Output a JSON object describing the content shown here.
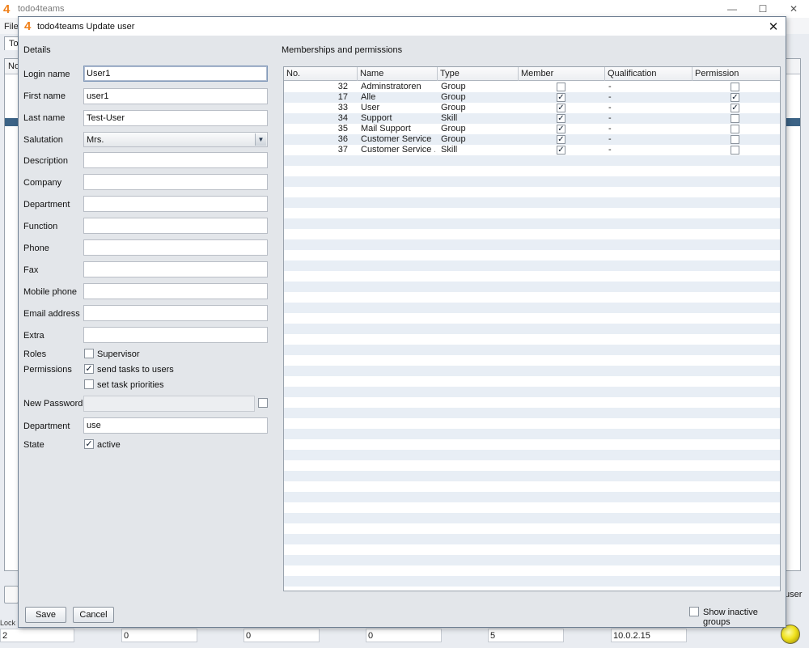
{
  "main_window": {
    "logo": "4",
    "title": "todo4teams",
    "menu_file": "File",
    "tab_label": "To",
    "table_header": "No",
    "user_label": "user",
    "lock_label": "Lock",
    "status_cells": [
      "2",
      "0",
      "0",
      "0",
      "5",
      "10.0.2.15"
    ]
  },
  "dialog": {
    "logo": "4",
    "title": "todo4teams Update user",
    "details_heading": "Details",
    "fields": {
      "login_name": {
        "label": "Login name",
        "value": "User1"
      },
      "first_name": {
        "label": "First name",
        "value": "user1"
      },
      "last_name": {
        "label": "Last name",
        "value": "Test-User"
      },
      "salutation": {
        "label": "Salutation",
        "value": "Mrs."
      },
      "description": {
        "label": "Description",
        "value": ""
      },
      "company": {
        "label": "Company",
        "value": ""
      },
      "department": {
        "label": "Department",
        "value": ""
      },
      "function": {
        "label": "Function",
        "value": ""
      },
      "phone": {
        "label": "Phone",
        "value": ""
      },
      "fax": {
        "label": "Fax",
        "value": ""
      },
      "mobile_phone": {
        "label": "Mobile phone",
        "value": ""
      },
      "email_address": {
        "label": "Email address",
        "value": ""
      },
      "extra": {
        "label": "Extra",
        "value": ""
      },
      "new_password": {
        "label": "New Password",
        "value": ""
      },
      "department2": {
        "label": "Department",
        "value": "use"
      }
    },
    "roles": {
      "label": "Roles",
      "supervisor_label": "Supervisor",
      "supervisor_checked": false
    },
    "permissions": {
      "label": "Permissions",
      "send_tasks_label": "send tasks to users",
      "send_tasks_checked": true,
      "set_priorities_label": "set task priorities",
      "set_priorities_checked": false
    },
    "state": {
      "label": "State",
      "active_label": "active",
      "active_checked": true
    },
    "memberships": {
      "heading": "Memberships and permissions",
      "columns": [
        "No.",
        "Name",
        "Type",
        "Member",
        "Qualification",
        "Permission"
      ],
      "rows": [
        {
          "no": "32",
          "name": "Adminstratoren",
          "type": "Group",
          "member": false,
          "qualification": "-",
          "permission": false
        },
        {
          "no": "17",
          "name": "Alle",
          "type": "Group",
          "member": true,
          "qualification": "-",
          "permission": true
        },
        {
          "no": "33",
          "name": "User",
          "type": "Group",
          "member": true,
          "qualification": "-",
          "permission": true
        },
        {
          "no": "34",
          "name": "Support",
          "type": "Skill",
          "member": true,
          "qualification": "-",
          "permission": false
        },
        {
          "no": "35",
          "name": "Mail Support",
          "type": "Group",
          "member": true,
          "qualification": "-",
          "permission": false
        },
        {
          "no": "36",
          "name": "Customer Service",
          "type": "Group",
          "member": true,
          "qualification": "-",
          "permission": false
        },
        {
          "no": "37",
          "name": "Customer Service ...",
          "type": "Skill",
          "member": true,
          "qualification": "-",
          "permission": false
        }
      ]
    },
    "show_inactive_label": "Show inactive groups",
    "show_inactive_checked": false,
    "save_label": "Save",
    "cancel_label": "Cancel"
  },
  "colors": {
    "brand": "#f08019",
    "selection": "#3c6386",
    "row_stripe": "#e8eef5"
  }
}
